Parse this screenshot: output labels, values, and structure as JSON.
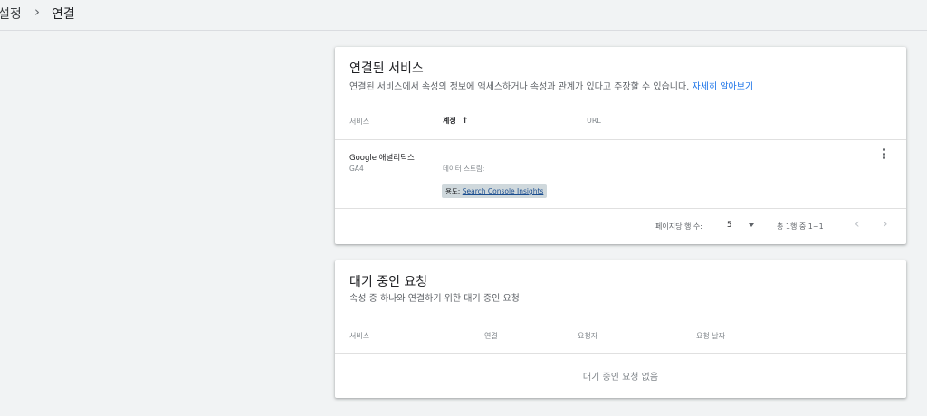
{
  "breadcrumb": {
    "parent": "설정",
    "separator": "›",
    "current": "연결"
  },
  "linked_services": {
    "title": "연결된 서비스",
    "subtitle": "연결된 서비스에서 속성의 정보에 액세스하거나 속성과 관계가 있다고 주장할 수 있습니다. ",
    "learn_more": "자세히 알아보기",
    "columns": {
      "service": "서비스",
      "account": "계정",
      "url": "URL"
    },
    "sort_icon": "↑",
    "row": {
      "service_name": "Google 애널리틱스",
      "service_type": "GA4",
      "stream_label": "데이터 스트림:",
      "usage_prefix": "용도: ",
      "usage_link": "Search Console Insights",
      "more_icon": "more-vert-icon"
    },
    "pagination": {
      "rows_per_page_label": "페이지당 행 수:",
      "rows_per_page": "5",
      "range": "총 1행 중 1~1",
      "prev": "‹",
      "next": "›"
    }
  },
  "pending_requests": {
    "title": "대기 중인 요청",
    "subtitle": "속성 중 하나와 연결하기 위한 대기 중인 요청",
    "columns": {
      "service": "서비스",
      "link": "연결",
      "requester": "요청자",
      "request_date": "요청 날짜"
    },
    "empty": "대기 중인 요청 없음"
  },
  "colors": {
    "accent": "#1a73e8",
    "chip_bg": "#cfd8dc",
    "page_bg": "#f1f3f4"
  }
}
